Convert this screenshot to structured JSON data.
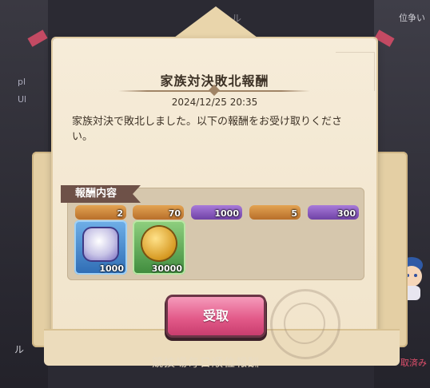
{
  "background": {
    "top_right": "位争い",
    "top_label": "ル",
    "left_texts": [
      "pl",
      "Ul"
    ],
    "bottom_left": "ル",
    "bottom_title": "競技場毎日順位報酬",
    "bottom_right": "取済み"
  },
  "dialog": {
    "title": "家族対決敗北報酬",
    "date": "2024/12/25  20:35",
    "message": "家族対決で敗北しました。以下の報酬をお受け取りください。"
  },
  "rewards": {
    "label": "報酬内容",
    "top_row": [
      {
        "qty": "2",
        "color": "orange"
      },
      {
        "qty": "70",
        "color": "orange"
      },
      {
        "qty": "1000",
        "color": "purple"
      },
      {
        "qty": "5",
        "color": "orange"
      },
      {
        "qty": "300",
        "color": "purple"
      }
    ],
    "row2": [
      {
        "qty": "1000",
        "icon": "gear-item-icon",
        "color": "blue"
      },
      {
        "qty": "30000",
        "icon": "gold-coin-icon",
        "color": "green"
      }
    ]
  },
  "button": {
    "label": "受取"
  },
  "colors": {
    "paper": "#f3e7d0",
    "button": "#e35b8a",
    "label_bg": "#6e5148",
    "text": "#3d3226"
  }
}
